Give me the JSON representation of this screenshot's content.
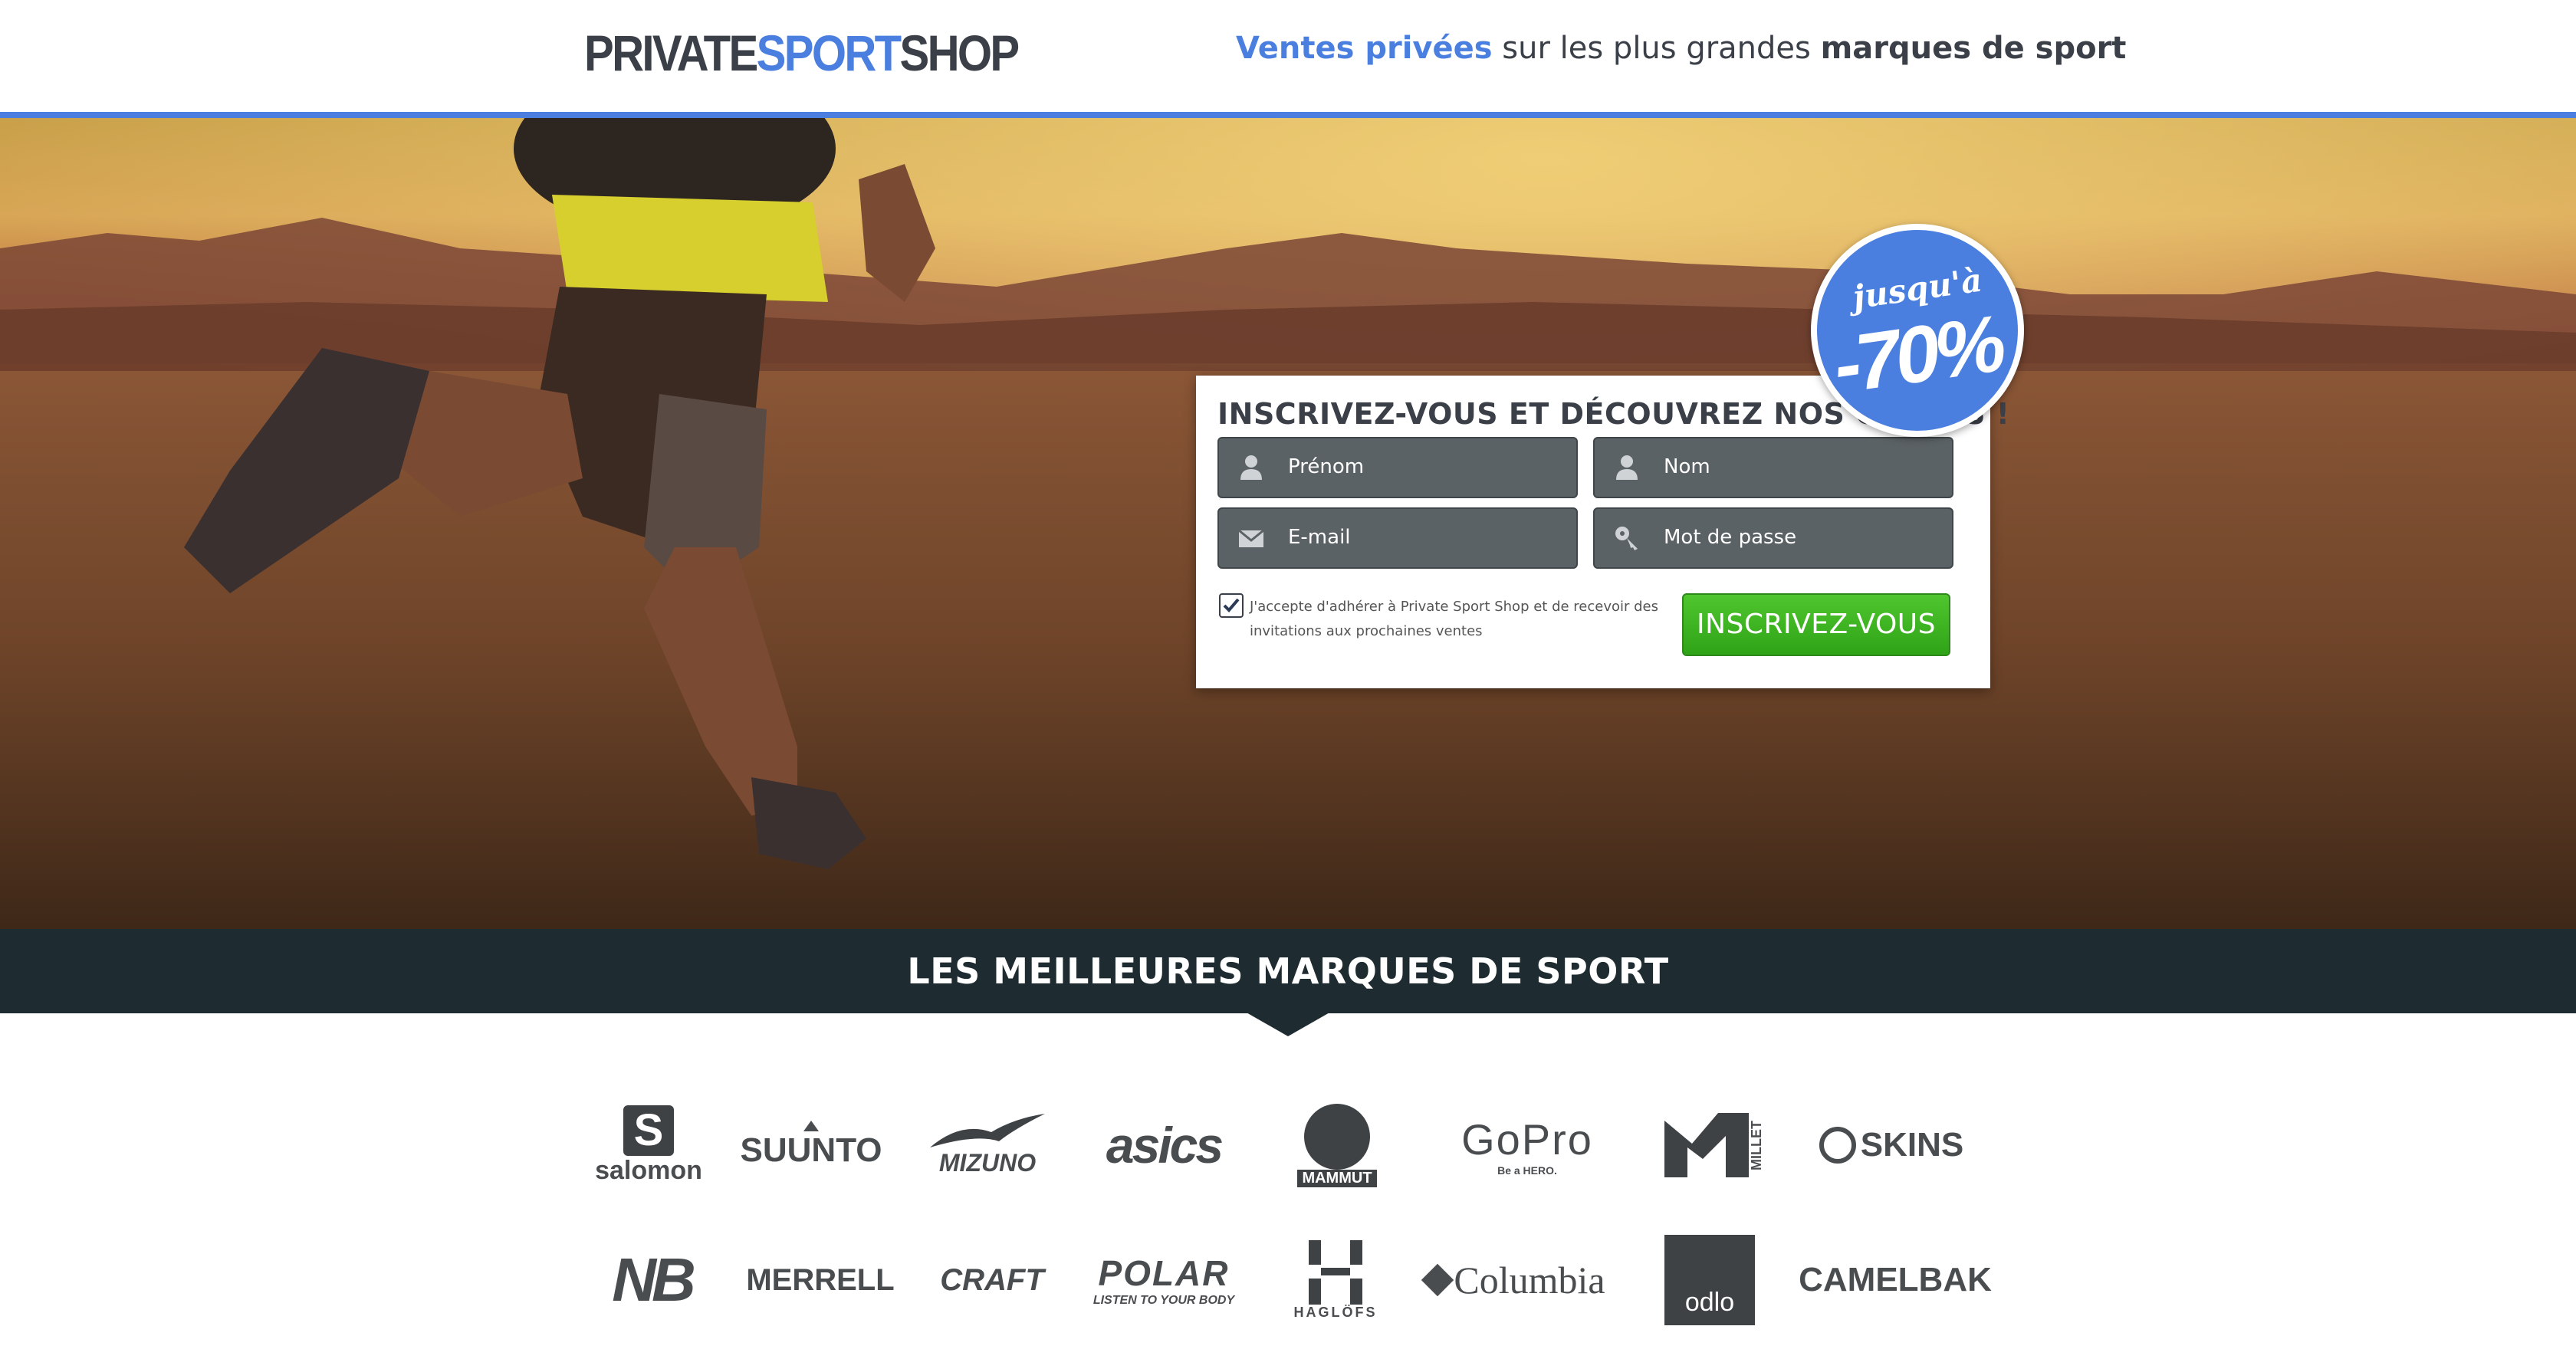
{
  "header": {
    "logo": {
      "part1": "PRIVATE",
      "part2": "SPORT",
      "part3": "SHOP"
    },
    "tagline": {
      "blue": "Ventes privées",
      "mid": " sur les plus grandes ",
      "bold": "marques de sport"
    }
  },
  "colors": {
    "brand_blue": "#4a7fe0",
    "dark": "#1e2b30",
    "green": "#3ab521"
  },
  "signup": {
    "title": "INSCRIVEZ-VOUS ET DÉCOUVREZ NOS OFFRES !",
    "firstname_placeholder": "Prénom",
    "lastname_placeholder": "Nom",
    "email_placeholder": "E-mail",
    "password_placeholder": "Mot de passe",
    "consent_text": "J'accepte d'adhérer à Private Sport Shop et de recevoir des invitations aux prochaines ventes",
    "consent_checked": true,
    "submit_label": "INSCRIVEZ-VOUS"
  },
  "badge": {
    "line1": "jusqu'à",
    "line2": "-70%"
  },
  "slider": {
    "count": 5,
    "active": 1
  },
  "brands_section": {
    "title": "LES MEILLEURES MARQUES DE SPORT"
  },
  "brands": {
    "row1": [
      "salomon",
      "SUUNTO",
      "MIZUNO",
      "asics",
      "MAMMUT",
      "GoPro",
      "MILLET",
      "SKINS"
    ],
    "row2": [
      "NB",
      "MERRELL",
      "CRAFT",
      "POLAR",
      "HAGLÖFS",
      "Columbia",
      "odlo",
      "CAMELBAK"
    ]
  },
  "brand_sublabels": {
    "gopro": "Be a HERO.",
    "polar": "LISTEN TO YOUR BODY"
  }
}
